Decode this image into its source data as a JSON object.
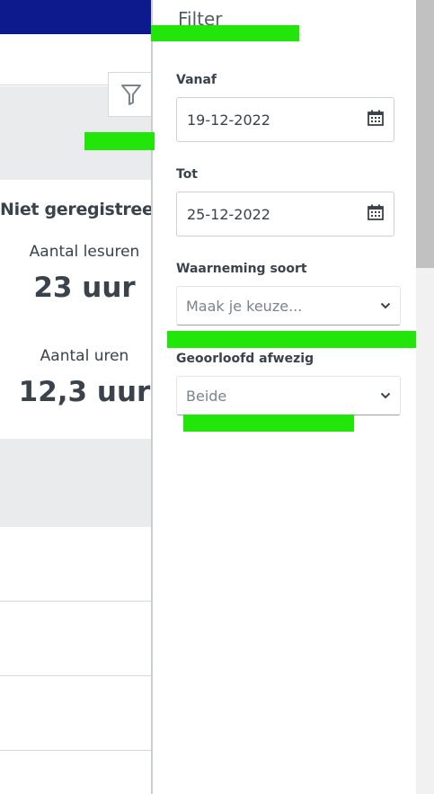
{
  "background_page": {
    "card_title": "Niet geregistreerd",
    "stats": [
      {
        "label": "Aantal lesuren",
        "value": "23 uur"
      },
      {
        "label": "Aantal uren",
        "value": "12,3 uur"
      }
    ]
  },
  "filter_panel": {
    "title": "Filter",
    "fields": {
      "from": {
        "label": "Vanaf",
        "value": "19-12-2022",
        "icon": "calendar-icon"
      },
      "to": {
        "label": "Tot",
        "value": "25-12-2022",
        "icon": "calendar-icon"
      },
      "observation_type": {
        "label": "Waarneming soort",
        "placeholder": "Maak je keuze...",
        "icon": "chevron-down-icon"
      },
      "authorized_absent": {
        "label": "Geoorloofd afwezig",
        "value": "Beide",
        "icon": "chevron-down-icon"
      }
    }
  },
  "colors": {
    "header_blue": "#0d1a8e",
    "gray_band": "#e9ebed",
    "redaction_green": "#22e60a",
    "text_dark": "#3a424b"
  }
}
